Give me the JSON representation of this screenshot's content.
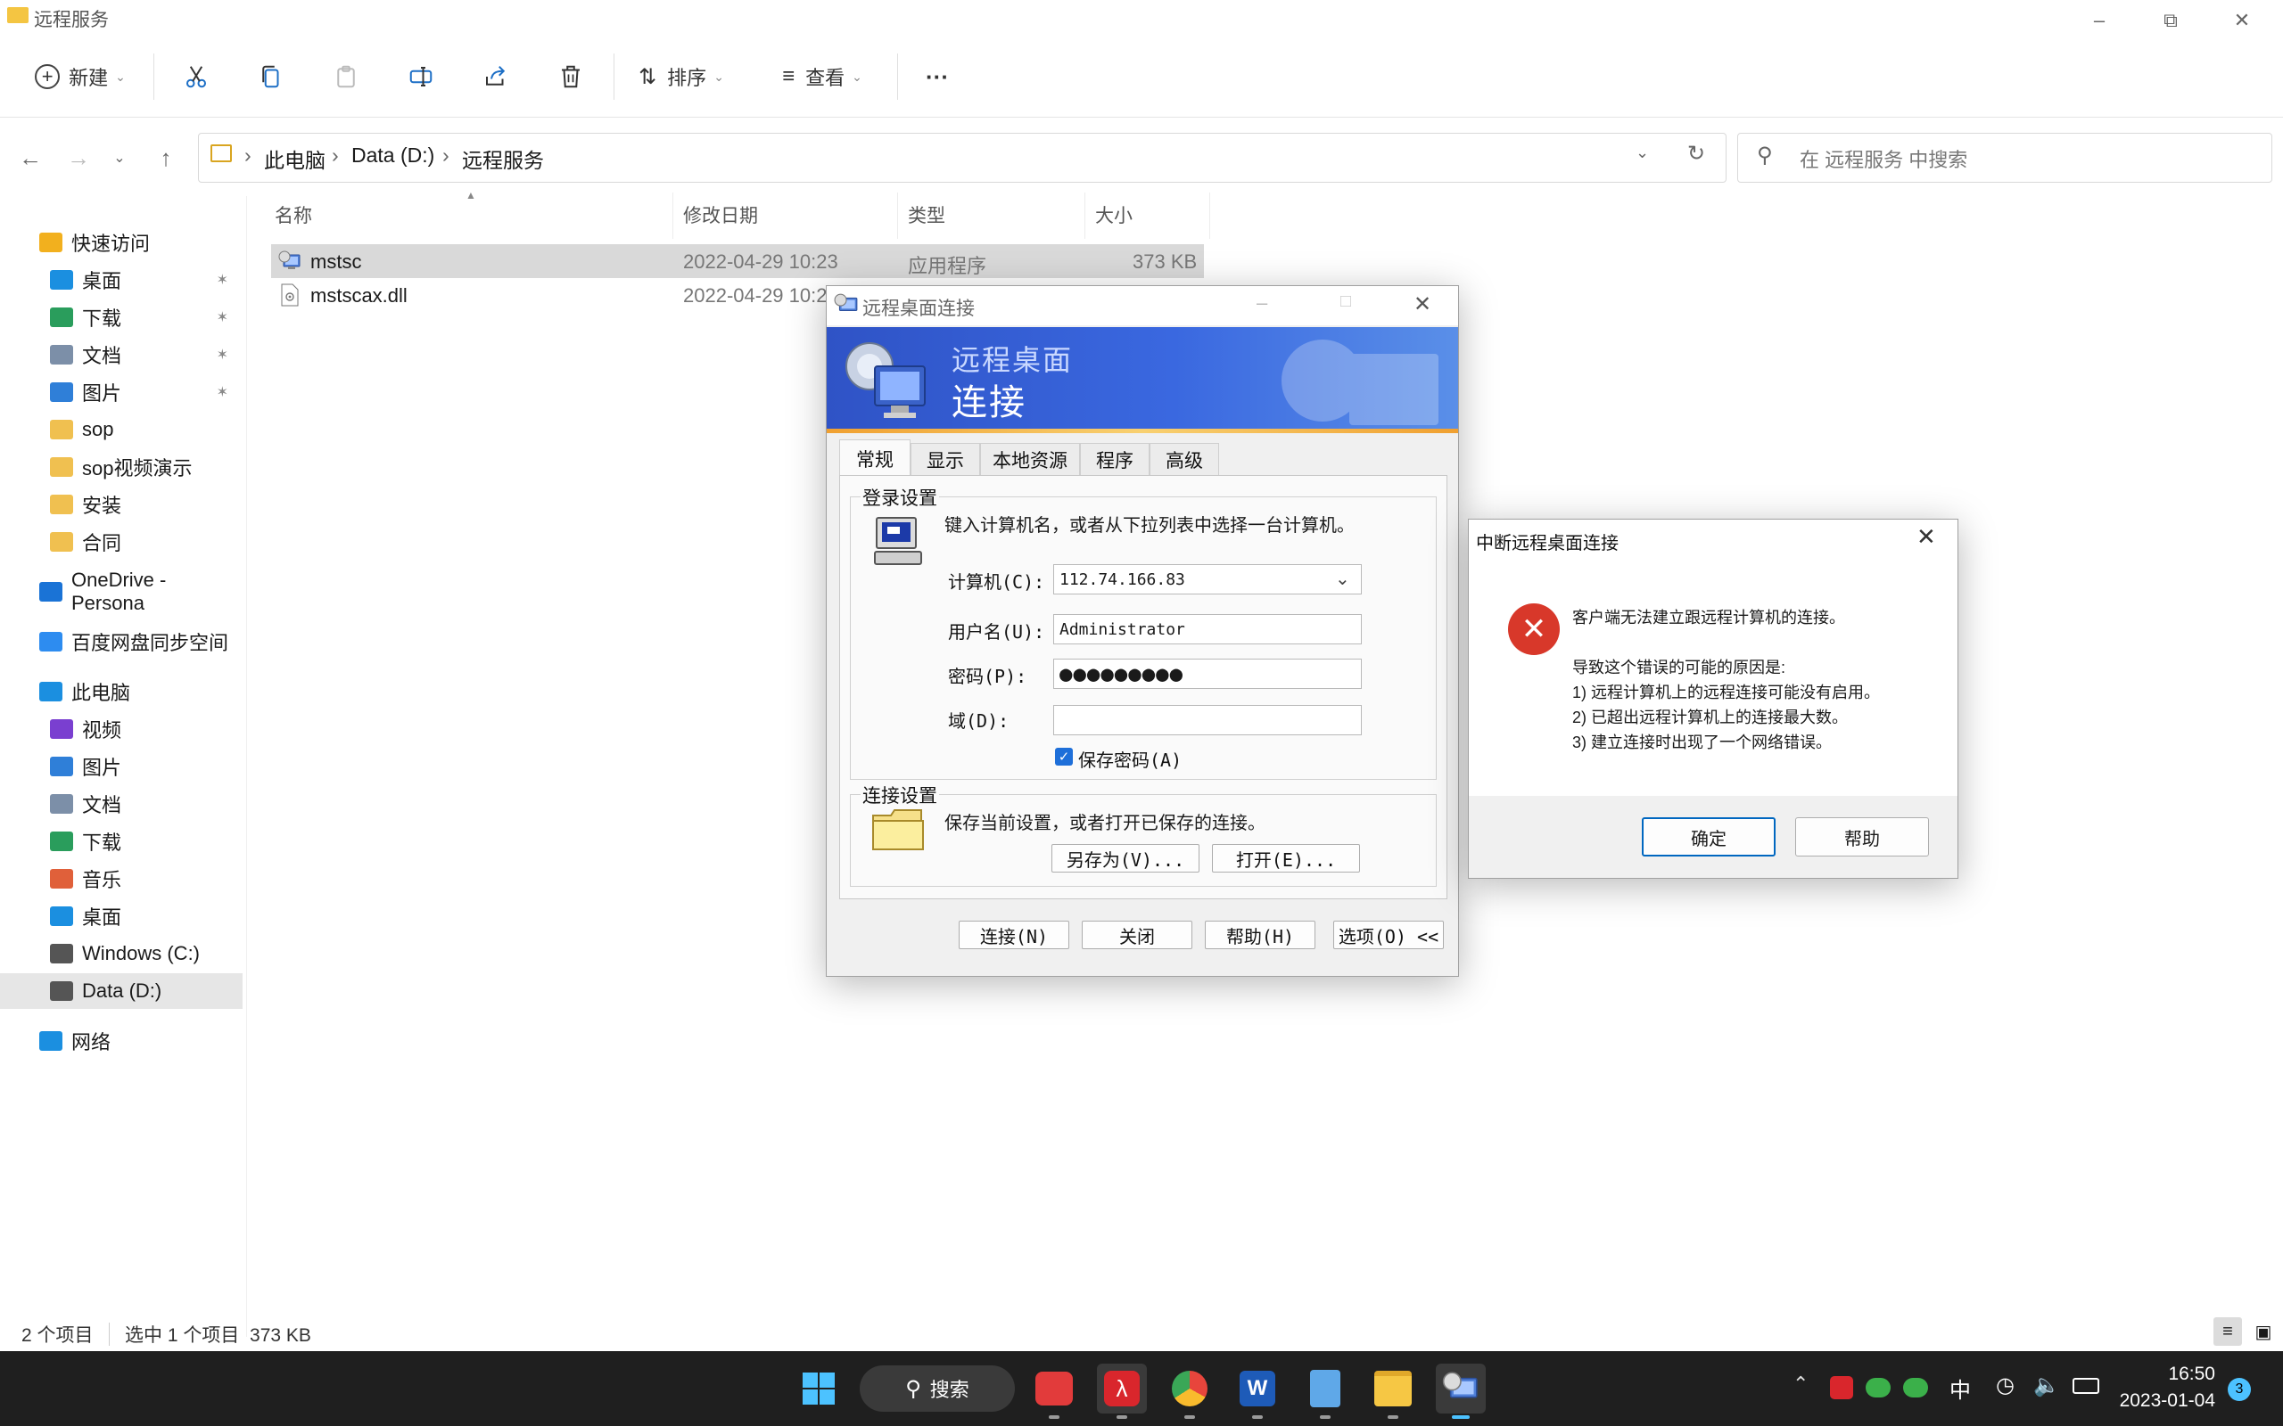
{
  "explorer": {
    "window_title": "远程服务",
    "toolbar": {
      "new_label": "新建",
      "sort_label": "排序",
      "view_label": "查看",
      "more_label": "···"
    },
    "breadcrumb": [
      "此电脑",
      "Data (D:)",
      "远程服务"
    ],
    "search_placeholder": "在 远程服务 中搜索",
    "sidebar": [
      {
        "label": "快速访问",
        "icon": "star-icon",
        "color": "#f2b01e"
      },
      {
        "label": "桌面",
        "icon": "desktop-icon",
        "color": "#1b8fe0",
        "pinned": true
      },
      {
        "label": "下载",
        "icon": "download-icon",
        "color": "#2a9d5c",
        "pinned": true
      },
      {
        "label": "文档",
        "icon": "document-icon",
        "color": "#7c8fa8",
        "pinned": true
      },
      {
        "label": "图片",
        "icon": "pictures-icon",
        "color": "#2f7fd8",
        "pinned": true
      },
      {
        "label": "sop",
        "icon": "folder-icon",
        "color": "#f0c050"
      },
      {
        "label": "sop视频演示",
        "icon": "folder-icon",
        "color": "#f0c050"
      },
      {
        "label": "安装",
        "icon": "folder-icon",
        "color": "#f0c050"
      },
      {
        "label": "合同",
        "icon": "folder-icon",
        "color": "#f0c050"
      },
      {
        "label": "OneDrive - Persona",
        "icon": "cloud-icon",
        "color": "#1a73d6"
      },
      {
        "label": "百度网盘同步空间",
        "icon": "baidu-netdisk-icon",
        "color": "#2d8cf0"
      },
      {
        "label": "此电脑",
        "icon": "computer-icon",
        "color": "#1b8fe0"
      },
      {
        "label": "视频",
        "icon": "video-icon",
        "color": "#7a3fd0"
      },
      {
        "label": "图片",
        "icon": "pictures-icon",
        "color": "#2f7fd8"
      },
      {
        "label": "文档",
        "icon": "document-icon",
        "color": "#7c8fa8"
      },
      {
        "label": "下载",
        "icon": "download-icon",
        "color": "#2a9d5c"
      },
      {
        "label": "音乐",
        "icon": "music-icon",
        "color": "#e0603a"
      },
      {
        "label": "桌面",
        "icon": "desktop-icon",
        "color": "#1b8fe0"
      },
      {
        "label": "Windows (C:)",
        "icon": "drive-icon",
        "color": "#555555"
      },
      {
        "label": "Data (D:)",
        "icon": "drive-icon",
        "color": "#555555",
        "selected": true
      },
      {
        "label": "网络",
        "icon": "network-icon",
        "color": "#1b8fe0"
      }
    ],
    "columns": [
      "名称",
      "修改日期",
      "类型",
      "大小"
    ],
    "files": [
      {
        "name": "mstsc",
        "date": "2022-04-29 10:23",
        "type": "应用程序",
        "size": "373 KB",
        "selected": true
      },
      {
        "name": "mstscax.dll",
        "date": "2022-04-29 10:23",
        "type": "",
        "size": ""
      }
    ],
    "status_count": "2 个项目",
    "status_selection": "选中 1 个项目  373 KB"
  },
  "rdp": {
    "title": "远程桌面连接",
    "banner_line1": "远程桌面",
    "banner_line2": "连接",
    "tabs": [
      "常规",
      "显示",
      "本地资源",
      "程序",
      "高级"
    ],
    "login_group": "登录设置",
    "login_hint": "键入计算机名，或者从下拉列表中选择一台计算机。",
    "computer_label": "计算机(C):",
    "computer_value": "112.74.166.83",
    "username_label": "用户名(U):",
    "username_value": "Administrator",
    "password_label": "密码(P):",
    "password_value": "●●●●●●●●●",
    "domain_label": "域(D):",
    "domain_value": "",
    "save_password_label": "保存密码(A)",
    "conn_group": "连接设置",
    "conn_hint": "保存当前设置，或者打开已保存的连接。",
    "save_as_label": "另存为(V)...",
    "open_label": "打开(E)...",
    "connect_label": "连接(N)",
    "close_label": "关闭",
    "help_label": "帮助(H)",
    "options_label": "选项(O) <<"
  },
  "error_dialog": {
    "title": "中断远程桌面连接",
    "message": "客户端无法建立跟远程计算机的连接。",
    "reasons_header": "导致这个错误的可能的原因是:",
    "reason1": "1) 远程计算机上的远程连接可能没有启用。",
    "reason2": "2) 已超出远程计算机上的连接最大数。",
    "reason3": "3) 建立连接时出现了一个网络错误。",
    "ok_label": "确定",
    "help_label": "帮助"
  },
  "taskbar": {
    "search_label": "搜索",
    "ime_label": "中",
    "time": "16:50",
    "date": "2023-01-04",
    "notification_count": "3"
  }
}
